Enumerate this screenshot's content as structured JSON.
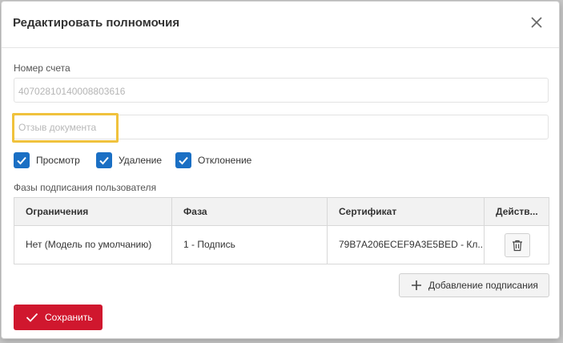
{
  "dialog": {
    "title": "Редактировать полномочия"
  },
  "account": {
    "label": "Номер счета",
    "value": "40702810140008803616"
  },
  "document_recall": {
    "placeholder": "Отзыв документа"
  },
  "permissions": [
    {
      "label": "Просмотр",
      "checked": true
    },
    {
      "label": "Удаление",
      "checked": true
    },
    {
      "label": "Отклонение",
      "checked": true
    }
  ],
  "signing_phases": {
    "label": "Фазы подписания пользователя",
    "columns": [
      "Ограничения",
      "Фаза",
      "Сертификат",
      "Действ..."
    ],
    "rows": [
      {
        "restriction": "Нет (Модель по умолчанию)",
        "phase": "1 - Подпись",
        "certificate": "79B7A206ECEF9A3E5BED - Кл...",
        "action_icon": "trash-icon"
      }
    ]
  },
  "buttons": {
    "add_signing": "Добавление подписания",
    "save": "Сохранить"
  },
  "colors": {
    "accent": "#1a6fc4",
    "save": "#d0172e",
    "highlight": "#f0c23c"
  }
}
